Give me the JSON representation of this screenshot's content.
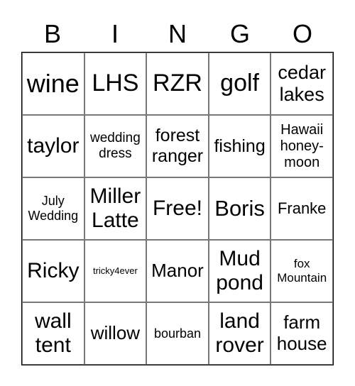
{
  "header": [
    "B",
    "I",
    "N",
    "G",
    "O"
  ],
  "cells": [
    {
      "text": "wine",
      "size": 36
    },
    {
      "text": "LHS",
      "size": 34
    },
    {
      "text": "RZR",
      "size": 34
    },
    {
      "text": "golf",
      "size": 34
    },
    {
      "text": "cedar lakes",
      "size": 27
    },
    {
      "text": "taylor",
      "size": 30
    },
    {
      "text": "wedding dress",
      "size": 19
    },
    {
      "text": "forest ranger",
      "size": 25
    },
    {
      "text": "fishing",
      "size": 25
    },
    {
      "text": "Hawaii honey-moon",
      "size": 20
    },
    {
      "text": "July Wedding",
      "size": 18
    },
    {
      "text": "Miller Latte",
      "size": 30
    },
    {
      "text": "Free!",
      "size": 30
    },
    {
      "text": "Boris",
      "size": 31
    },
    {
      "text": "Franke",
      "size": 22
    },
    {
      "text": "Ricky",
      "size": 30
    },
    {
      "text": "tricky4ever",
      "size": 13
    },
    {
      "text": "Manor",
      "size": 26
    },
    {
      "text": "Mud pond",
      "size": 30
    },
    {
      "text": "fox Mountain",
      "size": 17
    },
    {
      "text": "wall tent",
      "size": 30
    },
    {
      "text": "willow",
      "size": 26
    },
    {
      "text": "bourban",
      "size": 18
    },
    {
      "text": "land rover",
      "size": 30
    },
    {
      "text": "farm house",
      "size": 26
    }
  ]
}
